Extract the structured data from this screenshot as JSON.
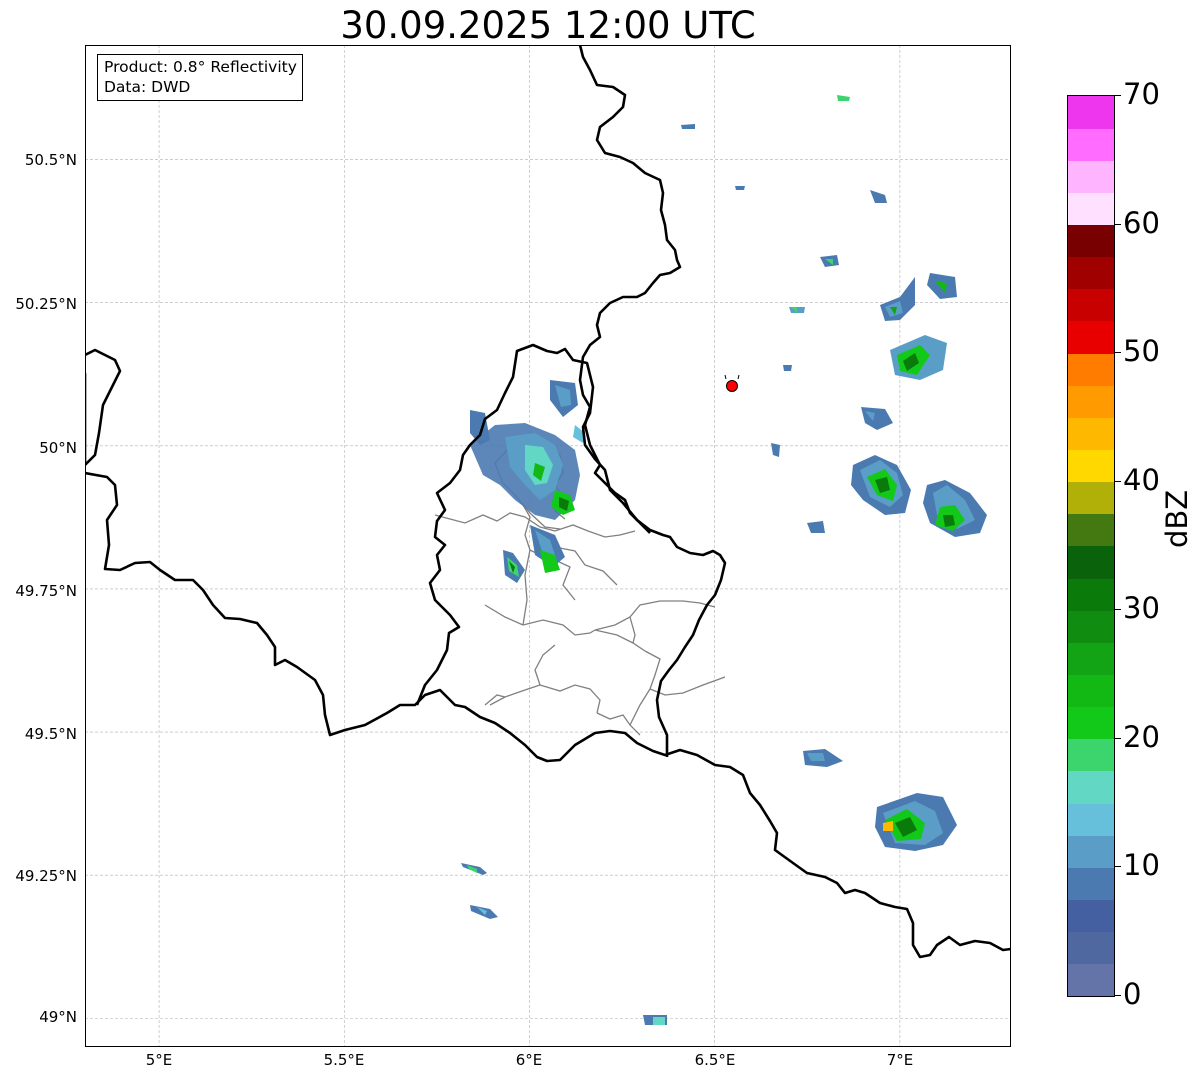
{
  "title": "30.09.2025 12:00 UTC",
  "info": {
    "product": "Product: 0.8° Reflectivity",
    "data": "Data: DWD"
  },
  "axes": {
    "lat_labels": [
      "50.5°N",
      "50.25°N",
      "50°N",
      "49.75°N",
      "49.5°N",
      "49.25°N",
      "49°N"
    ],
    "lon_labels": [
      "5°E",
      "5.5°E",
      "6°E",
      "6.5°E",
      "7°E"
    ],
    "lat_values": [
      50.5,
      50.25,
      50.0,
      49.75,
      49.5,
      49.25,
      49.0
    ],
    "lon_values": [
      5.0,
      5.5,
      6.0,
      6.5,
      7.0
    ],
    "extent": {
      "lon_min": 4.8,
      "lon_max": 7.3,
      "lat_min": 48.95,
      "lat_max": 50.7
    },
    "grid": true
  },
  "colorbar": {
    "label": "dBZ",
    "tick_labels": [
      "0",
      "10",
      "20",
      "30",
      "40",
      "50",
      "60",
      "70"
    ],
    "tick_values": [
      0,
      10,
      20,
      30,
      40,
      50,
      60,
      70
    ],
    "range": [
      0,
      70
    ],
    "colors": [
      "#6474a8",
      "#5068a0",
      "#4460a0",
      "#4a7ab0",
      "#5a9ec8",
      "#66c0dc",
      "#62d8c4",
      "#3cd46c",
      "#12c818",
      "#12b814",
      "#12a414",
      "#108c10",
      "#0a7a0a",
      "#0a620a",
      "#447810",
      "#b0b008",
      "#ffd800",
      "#ffb800",
      "#ff9a00",
      "#ff7c00",
      "#e80000",
      "#c80000",
      "#a00000",
      "#780000",
      "#ffe0ff",
      "#ffb4ff",
      "#ff6cff",
      "#ee36ee"
    ]
  },
  "radar_site": {
    "lon": 6.548,
    "lat": 50.108,
    "color": "#ff0000"
  }
}
